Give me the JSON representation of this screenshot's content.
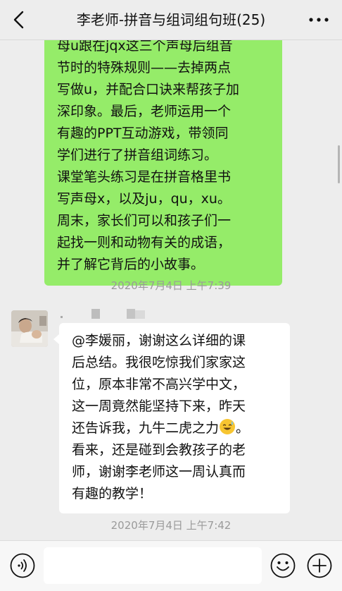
{
  "header": {
    "title": "李老师-拼音与组词组句班(25)",
    "back_icon": "chevron-left-icon",
    "more_icon": "more-dots-icon"
  },
  "messages": [
    {
      "type": "outgoing",
      "lines": [
        "母u跟在jqx这三个声母后组音",
        "节时的特殊规则——去掉两点",
        "写做u，并配合口诀来帮孩子加",
        "深印象。最后，老师运用一个",
        "有趣的PPT互动游戏，带领同",
        "学们进行了拼音组词练习。",
        "课堂笔头练习是在拼音格里书",
        "写声母x，以及ju，qu，xu。",
        "周末，家长们可以和孩子们一",
        "起找一则和动物有关的成语，",
        "并了解它背后的小故事。"
      ]
    },
    {
      "type": "timestamp",
      "text": "2020年7月4日 上午7:39"
    },
    {
      "type": "incoming",
      "lines": [
        "@李媛丽，谢谢这么详细的课",
        "后总结。我很吃惊我们家家这",
        "位，原本非常不高兴学中文，",
        "这一周竟然能坚持下来，昨天",
        "还告诉我，九牛二虎之力"
      ],
      "emoji": "sweat-smile-emoji-icon",
      "lines_after": [
        "看来，还是碰到会教孩子的老",
        "师，谢谢李老师这一周认真而",
        "有趣的教学！"
      ]
    },
    {
      "type": "timestamp",
      "text": "2020年7月4日 上午7:42"
    }
  ],
  "input_bar": {
    "placeholder": "",
    "value": "",
    "voice_icon": "voice-icon",
    "emoji_icon": "smiley-icon",
    "add_icon": "plus-circle-icon"
  }
}
